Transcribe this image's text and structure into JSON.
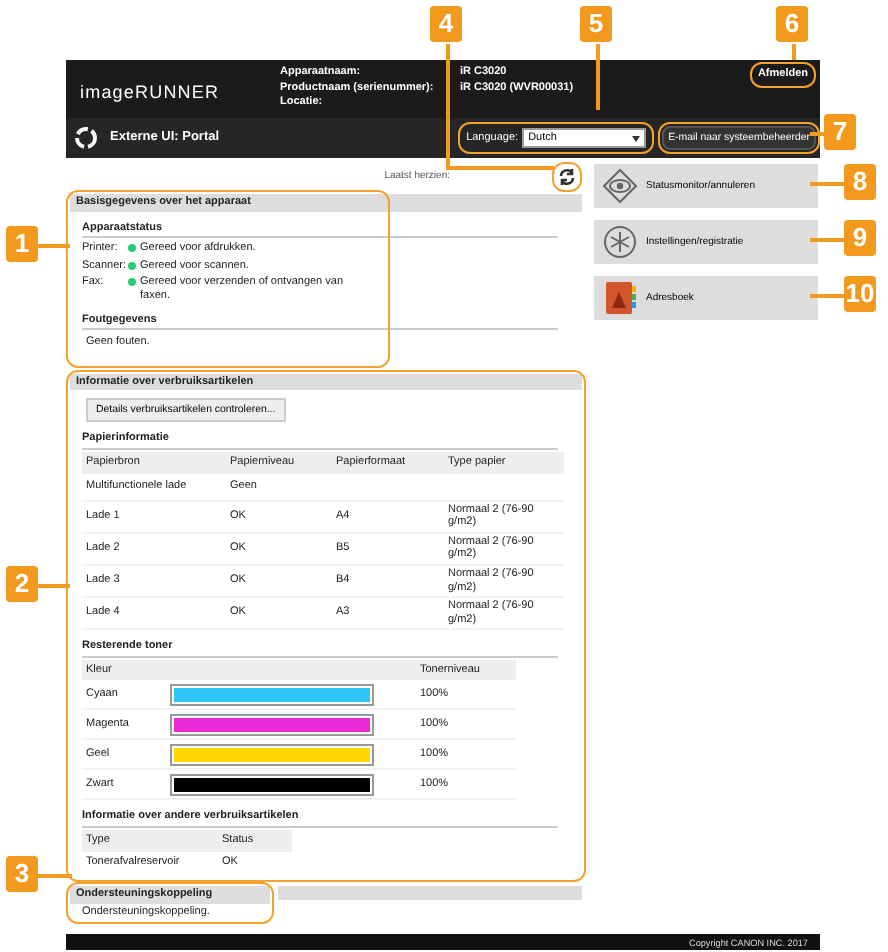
{
  "header": {
    "logo": "imageRUNNER",
    "device_info": [
      {
        "label": "Apparaatnaam:",
        "value": "iR C3020"
      },
      {
        "label": "Productnaam (serienummer):",
        "value": "iR C3020 (WVR00031)"
      },
      {
        "label": "Locatie:"
      }
    ],
    "logout": "Afmelden",
    "portal_title": "Externe UI: Portal",
    "language": {
      "label": "Language:",
      "value": "Dutch"
    },
    "email_button": "E-mail naar systeembeheerder"
  },
  "last_updated": "Laatst herzien:",
  "device_basics": {
    "title": "Basisgegevens over het apparaat",
    "status_title": "Apparaatstatus",
    "statuses": [
      {
        "device": "Printer:",
        "message": "Gereed voor afdrukken.",
        "color": "#2ecc71"
      },
      {
        "device": "Scanner:",
        "message": "Gereed voor scannen.",
        "color": "#2ecc71"
      },
      {
        "device": "Fax:",
        "message": "Gereed voor verzenden of ontvangen van faxen.",
        "color": "#2ecc71"
      }
    ],
    "error_title": "Foutgegevens",
    "error_message": "Geen fouten."
  },
  "consumables": {
    "title": "Informatie over verbruiksartikelen",
    "details_button": "Details verbruiksartikelen controleren...",
    "paper_title": "Papierinformatie",
    "paper_columns": [
      "Papierbron",
      "Papierniveau",
      "Papierformaat",
      "Type papier"
    ],
    "paper_rows": [
      [
        "Multifunctionele lade",
        "Geen",
        null,
        null
      ],
      [
        "Lade 1",
        "OK",
        "A4",
        "Normaal 2 (76-90 g/m2)"
      ],
      [
        "Lade 2",
        "OK",
        "B5",
        "Normaal 2 (76-90 g/m2)"
      ],
      [
        "Lade 3",
        "OK",
        "B4",
        "Normaal 2 (76-90 g/m2)"
      ],
      [
        "Lade 4",
        "OK",
        "A3",
        "Normaal 2 (76-90 g/m2)"
      ]
    ],
    "toner_title": "Resterende toner",
    "toner_columns": [
      "Kleur",
      "Tonerniveau"
    ],
    "toners": [
      {
        "name": "Cyaan",
        "color": "#2ec5f5",
        "level": 1,
        "reading": "100%"
      },
      {
        "name": "Magenta",
        "color": "#e92ad6",
        "level": 1,
        "reading": "100%"
      },
      {
        "name": "Geel",
        "color": "#fcd800",
        "level": 1,
        "reading": "100%"
      },
      {
        "name": "Zwart",
        "color": "#000000",
        "level": 1,
        "reading": "100%"
      }
    ],
    "other_title": "Informatie over andere verbruiksartikelen",
    "other_columns": [
      "Type",
      "Status"
    ],
    "other_rows": [
      [
        "Tonerafvalreservoir",
        "OK"
      ]
    ]
  },
  "support": {
    "title": "Ondersteuningskoppeling",
    "link": "Ondersteuningskoppeling."
  },
  "shortcuts": [
    {
      "kind": "monitor",
      "label": "Statusmonitor/annuleren"
    },
    {
      "kind": "settings",
      "label": "Instellingen/registratie"
    },
    {
      "kind": "addressbook",
      "label": "Adresboek"
    }
  ],
  "footer": "Copyright CANON INC. 2017",
  "callouts": [
    {
      "number": "1"
    },
    {
      "number": "2"
    },
    {
      "number": "3"
    },
    {
      "number": "4"
    },
    {
      "number": "5"
    },
    {
      "number": "6"
    },
    {
      "number": "7"
    },
    {
      "number": "8"
    },
    {
      "number": "9"
    },
    {
      "number": "10"
    }
  ]
}
